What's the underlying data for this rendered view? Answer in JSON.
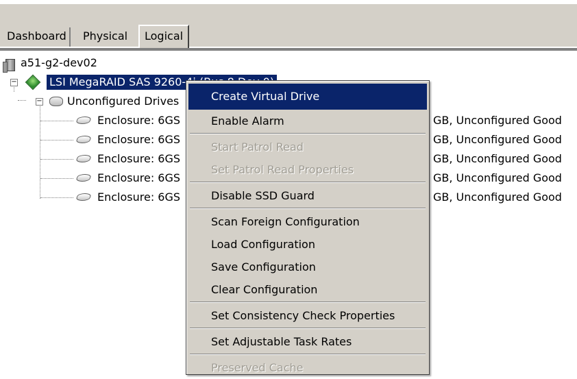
{
  "tabs": [
    "Dashboard",
    "Physical",
    "Logical"
  ],
  "tree": {
    "host": "a51-g2-dev02",
    "controller": "LSI MegaRAID SAS 9260-4i (Bus 8,Dev 0)",
    "group": "Unconfigured Drives",
    "enclosures": [
      {
        "label": "Enclosure: 6GS",
        "suffix": "GB, Unconfigured Good"
      },
      {
        "label": "Enclosure: 6GS",
        "suffix": "GB, Unconfigured Good"
      },
      {
        "label": "Enclosure: 6GS",
        "suffix": "GB, Unconfigured Good"
      },
      {
        "label": "Enclosure: 6GS",
        "suffix": "GB, Unconfigured Good"
      },
      {
        "label": "Enclosure: 6GS",
        "suffix": "GB, Unconfigured Good"
      }
    ]
  },
  "context_menu": {
    "items": [
      {
        "label": "Create Virtual Drive",
        "state": "highlighted"
      },
      {
        "label": "Enable Alarm",
        "state": "enabled"
      },
      {
        "label": "Start Patrol Read",
        "state": "disabled"
      },
      {
        "label": "Set Patrol Read Properties",
        "state": "disabled"
      },
      {
        "label": "Disable SSD Guard",
        "state": "enabled"
      },
      {
        "label": "Scan Foreign Configuration",
        "state": "enabled"
      },
      {
        "label": "Load Configuration",
        "state": "enabled"
      },
      {
        "label": "Save Configuration",
        "state": "enabled"
      },
      {
        "label": "Clear Configuration",
        "state": "enabled"
      },
      {
        "label": "Set Consistency Check Properties",
        "state": "enabled"
      },
      {
        "label": "Set Adjustable Task Rates",
        "state": "enabled"
      },
      {
        "label": "Preserved Cache",
        "state": "disabled"
      }
    ]
  },
  "colors": {
    "selection": "#0a246a",
    "chrome": "#d4d0c8",
    "disabled_text": "#a09d94"
  },
  "icons": {
    "host": "server-icon",
    "controller": "controller-diamond-icon",
    "group": "drive-group-icon",
    "enclosure": "disk-icon",
    "expander": "tree-collapse-icon"
  }
}
